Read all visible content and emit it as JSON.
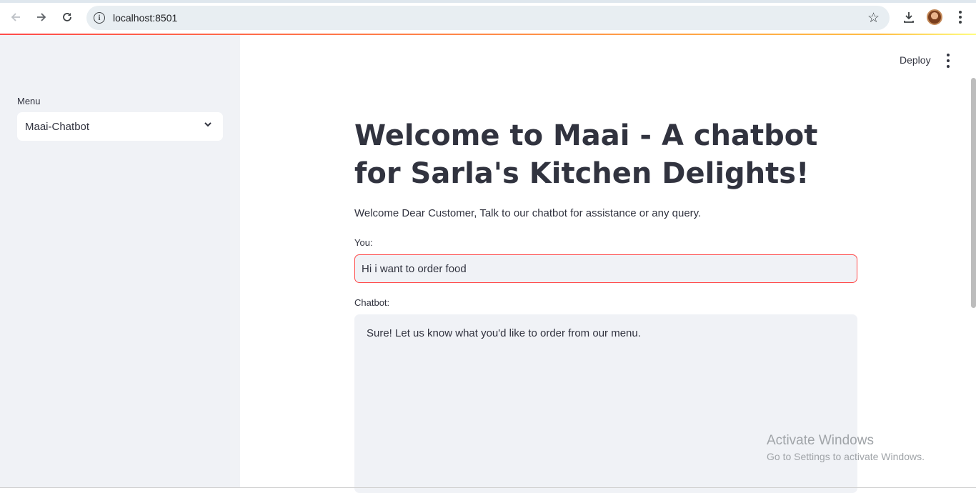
{
  "browser": {
    "url": "localhost:8501",
    "icons": [
      "back-icon",
      "forward-icon",
      "reload-icon",
      "site-info-icon",
      "bookmark-star-icon",
      "download-icon",
      "profile-avatar",
      "chrome-menu-icon"
    ]
  },
  "sidebar": {
    "menu_label": "Menu",
    "select_value": "Maai-Chatbot"
  },
  "header": {
    "deploy_label": "Deploy"
  },
  "main": {
    "title": "Welcome to Maai - A chatbot for Sarla's Kitchen Delights!",
    "subtitle": "Welcome Dear Customer, Talk to our chatbot for assistance or any query.",
    "you_label": "You:",
    "you_value": "Hi i want to order food",
    "chatbot_label": "Chatbot:",
    "chatbot_reply": "Sure! Let us know what you'd like to order from our menu."
  },
  "watermark": {
    "line1": "Activate Windows",
    "line2": "Go to Settings to activate Windows."
  },
  "colors": {
    "accent": "#ff4b4b",
    "sidebar_bg": "#f0f2f6",
    "text": "#31333f"
  }
}
